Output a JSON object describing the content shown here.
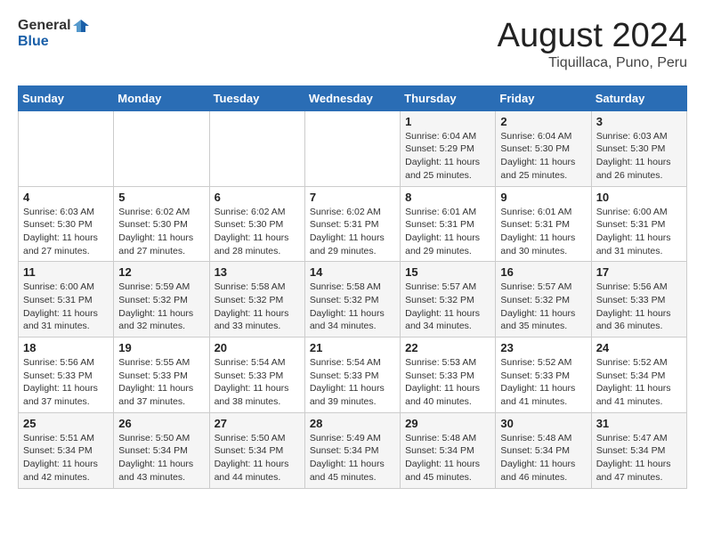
{
  "header": {
    "logo_line1": "General",
    "logo_line2": "Blue",
    "title": "August 2024",
    "subtitle": "Tiquillaca, Puno, Peru"
  },
  "calendar": {
    "days_of_week": [
      "Sunday",
      "Monday",
      "Tuesday",
      "Wednesday",
      "Thursday",
      "Friday",
      "Saturday"
    ],
    "weeks": [
      [
        {
          "day": "",
          "info": ""
        },
        {
          "day": "",
          "info": ""
        },
        {
          "day": "",
          "info": ""
        },
        {
          "day": "",
          "info": ""
        },
        {
          "day": "1",
          "info": "Sunrise: 6:04 AM\nSunset: 5:29 PM\nDaylight: 11 hours and 25 minutes."
        },
        {
          "day": "2",
          "info": "Sunrise: 6:04 AM\nSunset: 5:30 PM\nDaylight: 11 hours and 25 minutes."
        },
        {
          "day": "3",
          "info": "Sunrise: 6:03 AM\nSunset: 5:30 PM\nDaylight: 11 hours and 26 minutes."
        }
      ],
      [
        {
          "day": "4",
          "info": "Sunrise: 6:03 AM\nSunset: 5:30 PM\nDaylight: 11 hours and 27 minutes."
        },
        {
          "day": "5",
          "info": "Sunrise: 6:02 AM\nSunset: 5:30 PM\nDaylight: 11 hours and 27 minutes."
        },
        {
          "day": "6",
          "info": "Sunrise: 6:02 AM\nSunset: 5:30 PM\nDaylight: 11 hours and 28 minutes."
        },
        {
          "day": "7",
          "info": "Sunrise: 6:02 AM\nSunset: 5:31 PM\nDaylight: 11 hours and 29 minutes."
        },
        {
          "day": "8",
          "info": "Sunrise: 6:01 AM\nSunset: 5:31 PM\nDaylight: 11 hours and 29 minutes."
        },
        {
          "day": "9",
          "info": "Sunrise: 6:01 AM\nSunset: 5:31 PM\nDaylight: 11 hours and 30 minutes."
        },
        {
          "day": "10",
          "info": "Sunrise: 6:00 AM\nSunset: 5:31 PM\nDaylight: 11 hours and 31 minutes."
        }
      ],
      [
        {
          "day": "11",
          "info": "Sunrise: 6:00 AM\nSunset: 5:31 PM\nDaylight: 11 hours and 31 minutes."
        },
        {
          "day": "12",
          "info": "Sunrise: 5:59 AM\nSunset: 5:32 PM\nDaylight: 11 hours and 32 minutes."
        },
        {
          "day": "13",
          "info": "Sunrise: 5:58 AM\nSunset: 5:32 PM\nDaylight: 11 hours and 33 minutes."
        },
        {
          "day": "14",
          "info": "Sunrise: 5:58 AM\nSunset: 5:32 PM\nDaylight: 11 hours and 34 minutes."
        },
        {
          "day": "15",
          "info": "Sunrise: 5:57 AM\nSunset: 5:32 PM\nDaylight: 11 hours and 34 minutes."
        },
        {
          "day": "16",
          "info": "Sunrise: 5:57 AM\nSunset: 5:32 PM\nDaylight: 11 hours and 35 minutes."
        },
        {
          "day": "17",
          "info": "Sunrise: 5:56 AM\nSunset: 5:33 PM\nDaylight: 11 hours and 36 minutes."
        }
      ],
      [
        {
          "day": "18",
          "info": "Sunrise: 5:56 AM\nSunset: 5:33 PM\nDaylight: 11 hours and 37 minutes."
        },
        {
          "day": "19",
          "info": "Sunrise: 5:55 AM\nSunset: 5:33 PM\nDaylight: 11 hours and 37 minutes."
        },
        {
          "day": "20",
          "info": "Sunrise: 5:54 AM\nSunset: 5:33 PM\nDaylight: 11 hours and 38 minutes."
        },
        {
          "day": "21",
          "info": "Sunrise: 5:54 AM\nSunset: 5:33 PM\nDaylight: 11 hours and 39 minutes."
        },
        {
          "day": "22",
          "info": "Sunrise: 5:53 AM\nSunset: 5:33 PM\nDaylight: 11 hours and 40 minutes."
        },
        {
          "day": "23",
          "info": "Sunrise: 5:52 AM\nSunset: 5:33 PM\nDaylight: 11 hours and 41 minutes."
        },
        {
          "day": "24",
          "info": "Sunrise: 5:52 AM\nSunset: 5:34 PM\nDaylight: 11 hours and 41 minutes."
        }
      ],
      [
        {
          "day": "25",
          "info": "Sunrise: 5:51 AM\nSunset: 5:34 PM\nDaylight: 11 hours and 42 minutes."
        },
        {
          "day": "26",
          "info": "Sunrise: 5:50 AM\nSunset: 5:34 PM\nDaylight: 11 hours and 43 minutes."
        },
        {
          "day": "27",
          "info": "Sunrise: 5:50 AM\nSunset: 5:34 PM\nDaylight: 11 hours and 44 minutes."
        },
        {
          "day": "28",
          "info": "Sunrise: 5:49 AM\nSunset: 5:34 PM\nDaylight: 11 hours and 45 minutes."
        },
        {
          "day": "29",
          "info": "Sunrise: 5:48 AM\nSunset: 5:34 PM\nDaylight: 11 hours and 45 minutes."
        },
        {
          "day": "30",
          "info": "Sunrise: 5:48 AM\nSunset: 5:34 PM\nDaylight: 11 hours and 46 minutes."
        },
        {
          "day": "31",
          "info": "Sunrise: 5:47 AM\nSunset: 5:34 PM\nDaylight: 11 hours and 47 minutes."
        }
      ]
    ]
  }
}
